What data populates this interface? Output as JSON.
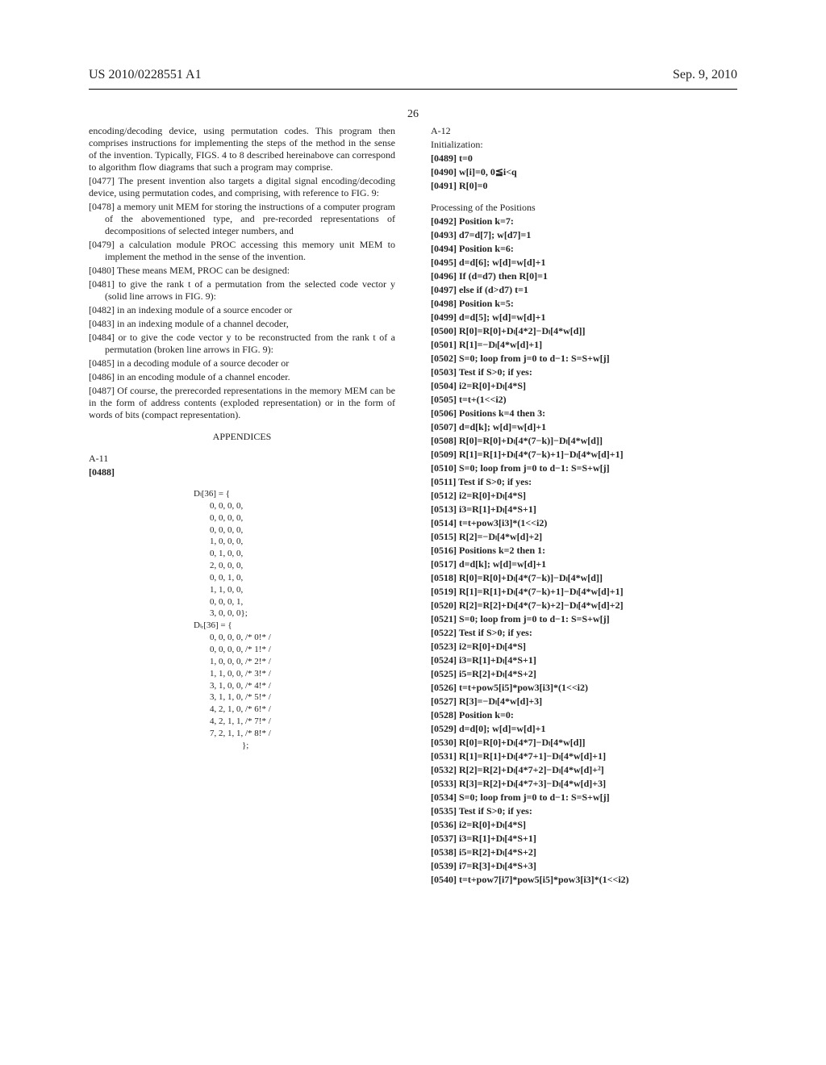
{
  "header": {
    "left": "US 2010/0228551 A1",
    "right": "Sep. 9, 2010"
  },
  "pagenum": "26",
  "left": {
    "intro": "encoding/decoding device, using permutation codes. This program then comprises instructions for implementing the steps of the method in the sense of the invention. Typically, FIGS. 4 to 8 described hereinabove can correspond to algorithm flow diagrams that such a program may comprise.",
    "p0477": "[0477]   The present invention also targets a digital signal encoding/decoding device, using permutation codes, and comprising, with reference to FIG. 9:",
    "p0478": "[0478]   a memory unit MEM for storing the instructions of a computer program of the abovementioned type, and pre-recorded representations of decompositions of selected integer numbers, and",
    "p0479": "[0479]   a calculation module PROC accessing this memory unit MEM to implement the method in the sense of the invention.",
    "p0480": "[0480]   These means MEM, PROC can be designed:",
    "p0481": "[0481]   to give the rank t of a permutation from the selected code vector y (solid line arrows in FIG. 9):",
    "p0482": "[0482]   in an indexing module of a source encoder or",
    "p0483": "[0483]   in an indexing module of a channel decoder,",
    "p0484": "[0484]   or to give the code vector y to be reconstructed from the rank t of a permutation (broken line arrows in FIG. 9):",
    "p0485": "[0485]   in a decoding module of a source decoder or",
    "p0486": "[0486]   in an encoding module of a channel encoder.",
    "p0487": "[0487]   Of course, the prerecorded representations in the memory MEM can be in the form of address contents (exploded representation) or in the form of words of bits (compact representation).",
    "appendices": "APPENDICES",
    "a11": "A-11",
    "p0488": "[0488]",
    "dl36": "Dₗ[36] = {",
    "dl_rows": [
      "0, 0, 0, 0,",
      "0, 0, 0, 0,",
      "0, 0, 0, 0,",
      "1, 0, 0, 0,",
      "0, 1, 0, 0,",
      "2, 0, 0, 0,",
      "0, 0, 1, 0,",
      "1, 1, 0, 0,",
      "0, 0, 0, 1,",
      "3, 0, 0, 0};"
    ],
    "dl36b": "Dₗᵣ[36] = {",
    "dlb_rows": [
      "0, 0, 0, 0,  /* 0!* /",
      "0, 0, 0, 0,  /* 1!* /",
      "1, 0, 0, 0,  /* 2!* /",
      "1, 1, 0, 0,  /* 3!* /",
      "3, 1, 0, 0,  /* 4!* /",
      "3, 1, 1, 0,  /* 5!* /",
      "4, 2, 1, 0,  /* 6!* /",
      "4, 2, 1, 1,  /* 7!* /",
      "7, 2, 1, 1,  /* 8!* /"
    ],
    "dlb_close": "};"
  },
  "right": {
    "a12": "A-12",
    "init": "Initialization:",
    "p0489": "[0489]   t=0",
    "p0490": "[0490]   w[i]=0, 0≦i<q",
    "p0491": "[0491]   R[0]=0",
    "procpos": "Processing of the Positions",
    "p0492": "[0492]   Position k=7:",
    "p0493": "[0493]   d7=d[7]; w[d7]=1",
    "p0494": "[0494]   Position k=6:",
    "p0495": "[0495]   d=d[6]; w[d]=w[d]+1",
    "p0496": "[0496]   If (d=d7) then R[0]=1",
    "p0497": "[0497]   else if (d>d7) t=1",
    "p0498": "[0498]   Position k=5:",
    "p0499": "[0499]   d=d[5]; w[d]=w[d]+1",
    "p0500": "[0500]   R[0]=R[0]+Dₗ[4*2]−Dₗ[4*w[d]]",
    "p0501": "[0501]   R[1]=−Dₗ[4*w[d]+1]",
    "p0502": "[0502]   S=0; loop from j=0 to d−1: S=S+w[j]",
    "p0503": "[0503]   Test if S>0; if yes:",
    "p0504": "[0504]   i2=R[0]+Dₗ[4*S]",
    "p0505": "[0505]   t=t+(1<<i2)",
    "p0506": "[0506]   Positions k=4 then 3:",
    "p0507": "[0507]   d=d[k]; w[d]=w[d]+1",
    "p0508": "[0508]   R[0]=R[0]+Dₗ[4*(7−k)]−Dₗ[4*w[d]]",
    "p0509": "[0509]   R[1]=R[1]+Dₗ[4*(7−k)+1]−Dₗ[4*w[d]+1]",
    "p0510": "[0510]   S=0; loop from j=0 to d−1: S=S+w[j]",
    "p0511": "[0511]   Test if S>0; if yes:",
    "p0512": "[0512]   i2=R[0]+Dₗ[4*S]",
    "p0513": "[0513]   i3=R[1]+Dₗ[4*S+1]",
    "p0514": "[0514]   t=t+pow3[i3]*(1<<i2)",
    "p0515": "[0515]   R[2]=−Dₗ[4*w[d]+2]",
    "p0516": "[0516]   Positions k=2 then 1:",
    "p0517": "[0517]   d=d[k]; w[d]=w[d]+1",
    "p0518": "[0518]   R[0]=R[0]+Dₗ[4*(7−k)]−Dₗ[4*w[d]]",
    "p0519": "[0519]   R[1]=R[1]+Dₗ[4*(7−k)+1]−Dₗ[4*w[d]+1]",
    "p0520": "[0520]   R[2]=R[2]+Dₗ[4*(7−k)+2]−Dₗ[4*w[d]+2]",
    "p0521": "[0521]   S=0; loop from j=0 to d−1: S=S+w[j]",
    "p0522": "[0522]   Test if S>0; if yes:",
    "p0523": "[0523]   i2=R[0]+Dₗ[4*S]",
    "p0524": "[0524]   i3=R[1]+Dₗ[4*S+1]",
    "p0525": "[0525]   i5=R[2]+Dₗ[4*S+2]",
    "p0526": "[0526]   t=t+pow5[i5]*pow3[i3]*(1<<i2)",
    "p0527": "[0527]   R[3]=−Dₗ[4*w[d]+3]",
    "p0528": "[0528]   Position k=0:",
    "p0529": "[0529]   d=d[0]; w[d]=w[d]+1",
    "p0530": "[0530]   R[0]=R[0]+Dₗ[4*7]−Dₗ[4*w[d]]",
    "p0531": "[0531]   R[1]=R[1]+Dₗ[4*7+1]−Dₗ[4*w[d]+1]",
    "p0532": "[0532]   R[2]=R[2]+Dₗ[4*7+2]−Dₗ[4*w[d]+²]",
    "p0533": "[0533]   R[3]=R[2]+Dₗ[4*7+3]−Dₗ[4*w[d]+3]",
    "p0534": "[0534]   S=0; loop from j=0 to d−1: S=S+w[j]",
    "p0535": "[0535]   Test if S>0; if yes:",
    "p0536": "[0536]   i2=R[0]+Dₗ[4*S]",
    "p0537": "[0537]   i3=R[1]+Dₗ[4*S+1]",
    "p0538": "[0538]   i5=R[2]+Dₗ[4*S+2]",
    "p0539": "[0539]   i7=R[3]+Dₗ[4*S+3]",
    "p0540": "[0540]   t=t+pow7[i7]*pow5[i5]*pow3[i3]*(1<<i2)"
  }
}
